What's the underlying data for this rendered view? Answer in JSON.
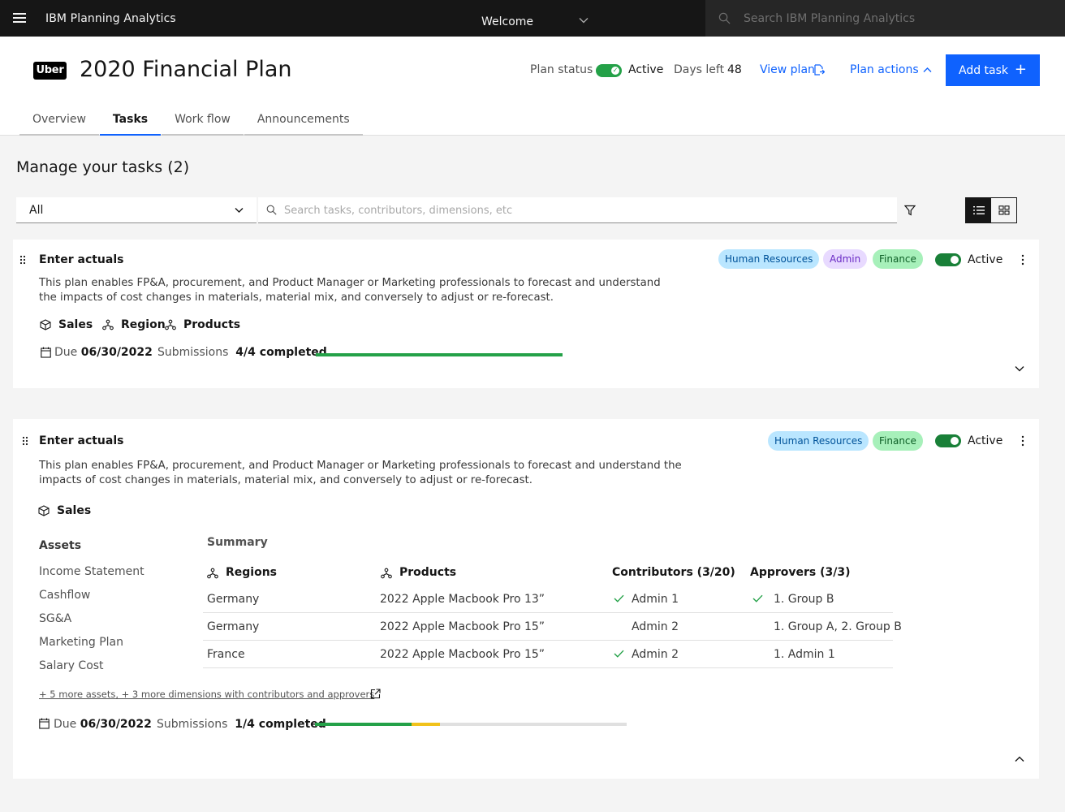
{
  "header": {
    "app_name": "IBM Planning Analytics",
    "welcome": "Welcome",
    "search_placeholder": "Search IBM Planning Analytics"
  },
  "plan": {
    "logo_text": "Uber",
    "title": "2020 Financial Plan",
    "status_label": "Plan status",
    "status_value": "Active",
    "days_left_label": "Days left",
    "days_left_value": "48",
    "view_plan_label": "View plan",
    "plan_actions_label": "Plan actions",
    "add_task_label": "Add task",
    "tabs": [
      {
        "label": "Overview",
        "active": false
      },
      {
        "label": "Tasks",
        "active": true
      },
      {
        "label": "Work flow",
        "active": false
      },
      {
        "label": "Announcements",
        "active": false
      }
    ]
  },
  "tasks_section": {
    "title": "Manage your tasks (2)",
    "filter_value": "All",
    "search_placeholder": "Search tasks, contributors, dimensions, etc"
  },
  "tasks": [
    {
      "title": "Enter actuals",
      "description_line1": "This plan enables FP&A, procurement, and Product Manager or Marketing professionals to forecast and understand",
      "description_line2": "the impacts of cost changes in materials, material mix, and conversely to adjust or re-forecast.",
      "tags": [
        "Human Resources",
        "Admin",
        "Finance"
      ],
      "status": "Active",
      "dimensions": [
        "Sales",
        "Region",
        "Products"
      ],
      "due_label": "Due",
      "due_date": "06/30/2022",
      "submissions_label": "Submissions",
      "submissions_value": "4/4 completed",
      "progress": {
        "completed": 1.0,
        "in_progress": 0.0
      }
    },
    {
      "title": "Enter actuals",
      "description_line1": "This plan enables FP&A, procurement, and Product Manager or Marketing professionals to forecast and understand the",
      "description_line2": "impacts of cost changes in materials, material mix, and conversely to adjust or re-forecast.",
      "tags": [
        "Human Resources",
        "Finance"
      ],
      "status": "Active",
      "dimensions": [
        "Sales"
      ],
      "assets_title": "Assets",
      "assets": [
        "Income Statement",
        "Cashflow",
        "SG&A",
        "Marketing Plan",
        "Salary Cost"
      ],
      "summary_title": "Summary",
      "summary_headers": [
        "Regions",
        "Products",
        "Contributors (3/20)",
        "Approvers (3/3)"
      ],
      "summary_rows": [
        {
          "region": "Germany",
          "product": "2022 Apple Macbook Pro 13”",
          "contributor": "Admin 1",
          "contributor_done": true,
          "approver": "1. Group B",
          "approver_done": true
        },
        {
          "region": "Germany",
          "product": "2022 Apple Macbook Pro 15”",
          "contributor": "Admin 2",
          "contributor_done": false,
          "approver": "1. Group A, 2. Group B",
          "approver_done": false
        },
        {
          "region": "France",
          "product": "2022 Apple Macbook Pro 15”",
          "contributor": "Admin 2",
          "contributor_done": true,
          "approver": "1. Admin 1",
          "approver_done": false
        }
      ],
      "more_link": "+ 5 more assets, + 3 more dimensions with contributors and approvers",
      "due_label": "Due",
      "due_date": "06/30/2022",
      "submissions_label": "Submissions",
      "submissions_value": "1/4 completed",
      "progress": {
        "completed": 0.31,
        "in_progress": 0.09
      }
    }
  ],
  "colors": {
    "accent": "#0f62fe",
    "success": "#24a148",
    "warning": "#f1c21b",
    "header_bg": "#161616"
  }
}
